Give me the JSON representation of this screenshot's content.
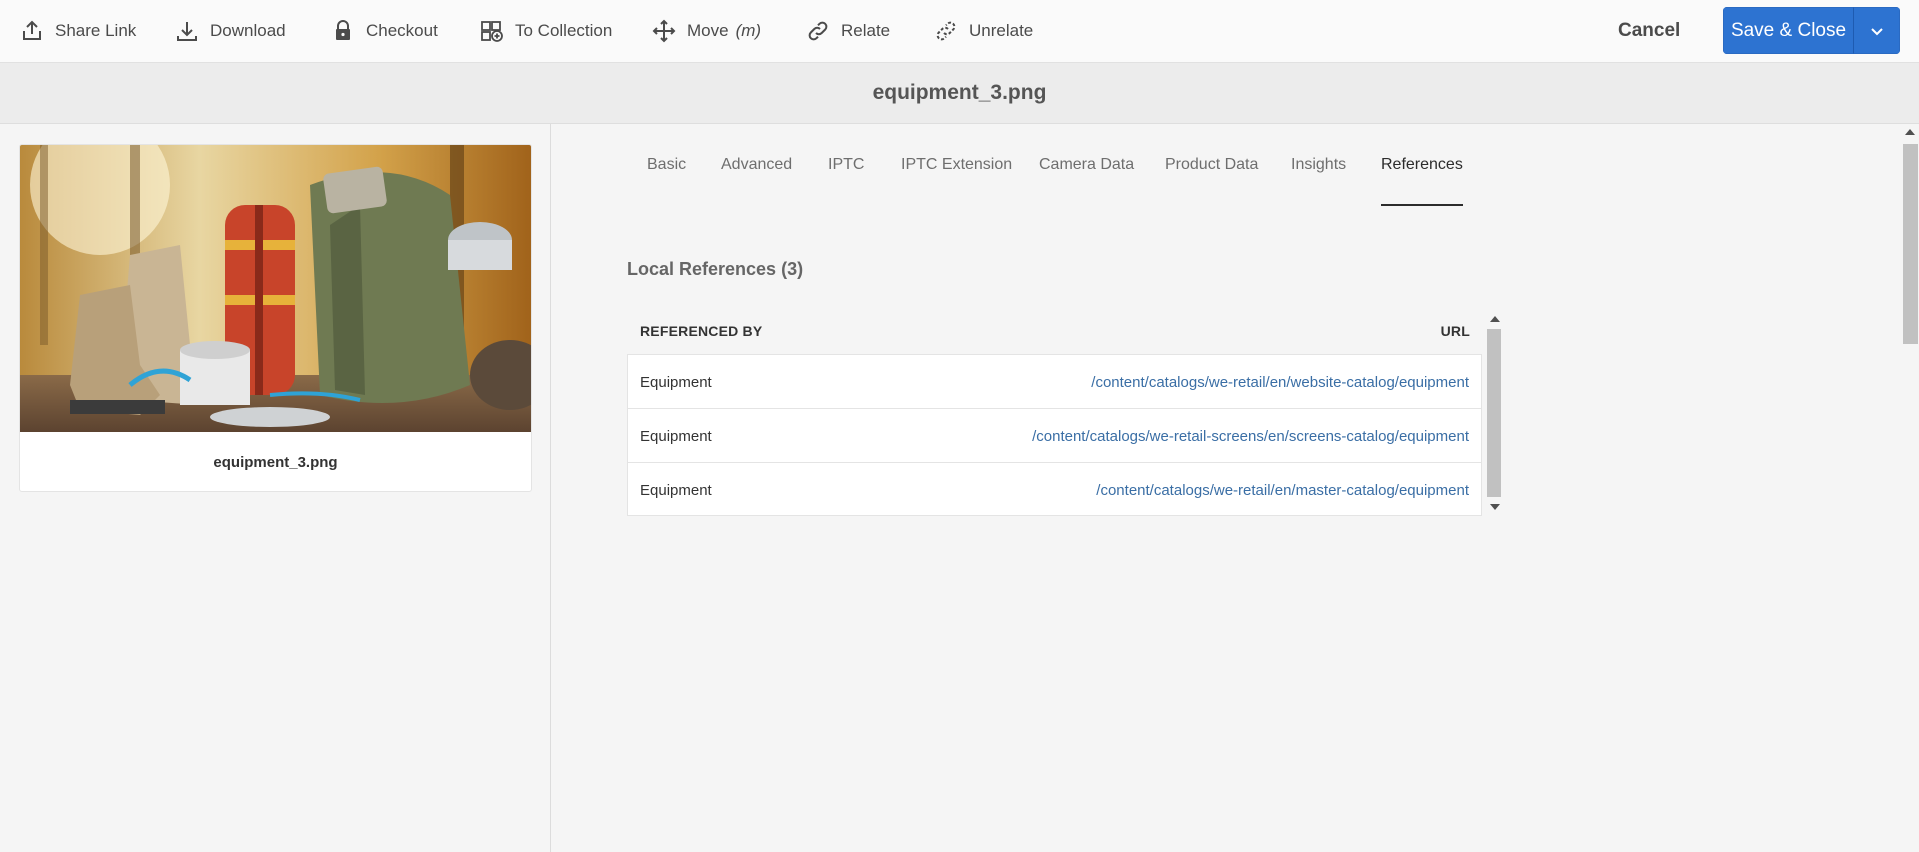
{
  "toolbar": {
    "items": [
      {
        "label": "Share Link",
        "icon": "share-icon"
      },
      {
        "label": "Download",
        "icon": "download-icon"
      },
      {
        "label": "Checkout",
        "icon": "lock-icon"
      },
      {
        "label": "To Collection",
        "icon": "add-to-collection-icon"
      },
      {
        "label": "Move",
        "shortcut": "(m)",
        "icon": "move-icon"
      },
      {
        "label": "Relate",
        "icon": "link-icon"
      },
      {
        "label": "Unrelate",
        "icon": "unlink-icon"
      }
    ],
    "cancel_label": "Cancel",
    "save_label": "Save & Close",
    "save_color": "#2d73d1"
  },
  "title": "equipment_3.png",
  "asset_card": {
    "name": "equipment_3.png",
    "image": "hiking-gear-image"
  },
  "tabs": [
    {
      "label": "Basic",
      "active": false
    },
    {
      "label": "Advanced",
      "active": false
    },
    {
      "label": "IPTC",
      "active": false
    },
    {
      "label": "IPTC Extension",
      "active": false
    },
    {
      "label": "Camera Data",
      "active": false
    },
    {
      "label": "Product Data",
      "active": false
    },
    {
      "label": "Insights",
      "active": false
    },
    {
      "label": "References",
      "active": true
    }
  ],
  "references": {
    "title": "Local References (3)",
    "columns": [
      "REFERENCED BY",
      "URL"
    ],
    "rows": [
      {
        "referenced_by": "Equipment",
        "url": "/content/catalogs/we-retail/en/website-catalog/equipment"
      },
      {
        "referenced_by": "Equipment",
        "url": "/content/catalogs/we-retail-screens/en/screens-catalog/equipment"
      },
      {
        "referenced_by": "Equipment",
        "url": "/content/catalogs/we-retail/en/master-catalog/equipment"
      }
    ],
    "link_color": "#3a6ea5"
  }
}
